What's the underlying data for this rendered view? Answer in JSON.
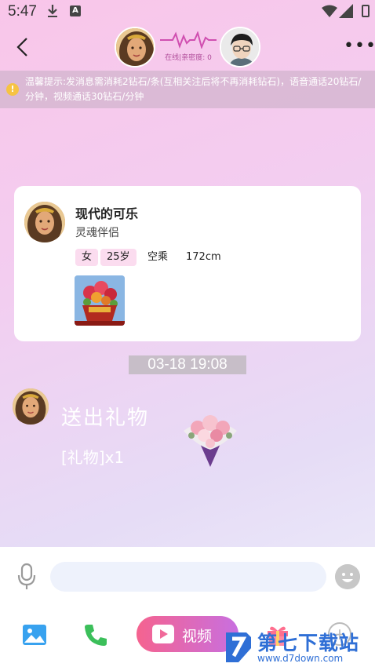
{
  "status_bar": {
    "time": "5:47",
    "icons": [
      "download-icon",
      "a-icon",
      "wifi-icon",
      "signal-icon",
      "battery-icon"
    ]
  },
  "header": {
    "online_status": "在线|亲密度: 0",
    "left_avatar": "female-avatar",
    "right_avatar": "male-avatar"
  },
  "notice": {
    "text": "温馨提示:发消息需消耗2钻石/条(互相关注后将不再消耗钻石)，语音通话20钻石/分钟，视频通话30钻石/分钟"
  },
  "profile_card": {
    "name": "现代的可乐",
    "subtitle": "灵魂伴侣",
    "tags": {
      "gender": "女",
      "age": "25岁",
      "job": "空乘",
      "height": "172cm"
    }
  },
  "chat": {
    "timestamp": "03-18 19:08",
    "message_title": "送出礼物",
    "message_sub": "[礼物]x1"
  },
  "input": {
    "placeholder": ""
  },
  "toolbar": {
    "video_label": "视频"
  },
  "watermark": {
    "title": "第七下载站",
    "url": "www.d7down.com"
  },
  "colors": {
    "accent_pink": "#f5638f",
    "accent_purple": "#c86fe0",
    "watermark_blue": "#2f6fd6"
  }
}
